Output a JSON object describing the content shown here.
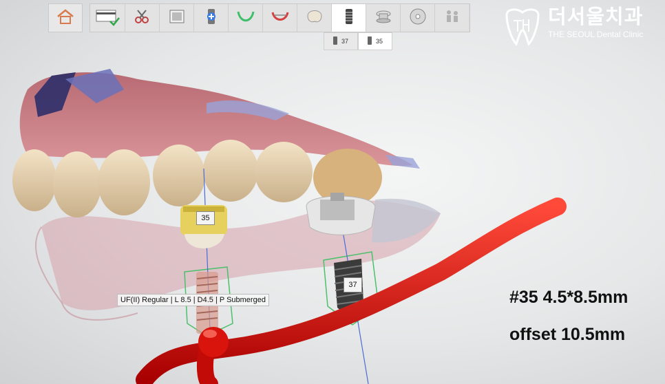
{
  "toolbar": {
    "home_icon": "home-icon",
    "steps": [
      {
        "icon": "scan-card-check-icon",
        "state": "done"
      },
      {
        "icon": "cut-scissors-icon"
      },
      {
        "icon": "image-frame-icon"
      },
      {
        "icon": "add-implant-icon"
      },
      {
        "icon": "arch-curve-icon"
      },
      {
        "icon": "align-arch-icon"
      },
      {
        "icon": "crown-tooth-icon"
      },
      {
        "icon": "implant-fixture-icon",
        "state": "active"
      },
      {
        "icon": "sleeve-ring-icon"
      },
      {
        "icon": "disc-export-icon"
      },
      {
        "icon": "people-icon",
        "state": "disabled"
      }
    ]
  },
  "subtabs": [
    {
      "label": "37",
      "icon": "implant-small-icon"
    },
    {
      "label": "35",
      "icon": "implant-small-icon",
      "active": true
    }
  ],
  "logo": {
    "korean": "더서울치과",
    "english": "THE SEOUL Dental Clinic"
  },
  "viewport": {
    "implant_35_label": "35",
    "implant_37_label": "37",
    "implant_info": "UF(II) Regular | L 8.5 | D4.5 | P Submerged",
    "nerve_color": "#e0120c"
  },
  "notes": {
    "line1": "#35  4.5*8.5mm",
    "line2": "offset 10.5mm"
  }
}
